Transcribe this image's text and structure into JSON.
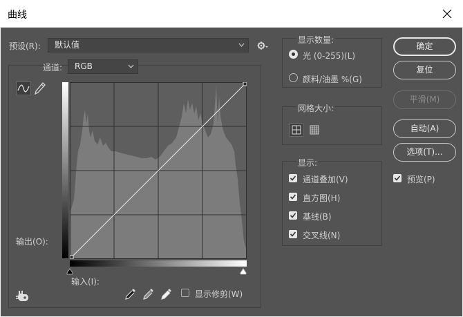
{
  "window": {
    "title": "曲线",
    "close_glyph": "✕"
  },
  "preset": {
    "label": "预设(R):",
    "value": "默认值",
    "gear_icon": "gear-icon"
  },
  "channel": {
    "label": "通道:",
    "value": "RGB"
  },
  "curve_tools": {
    "curve_icon": "curve-icon",
    "pencil_icon": "pencil-icon"
  },
  "output": {
    "label": "输出(O):"
  },
  "input": {
    "label": "输入(I):"
  },
  "show_clipping": {
    "label": "显示修剪(W)",
    "checked": false
  },
  "display_amount": {
    "title": "显示数量:",
    "options": [
      {
        "label": "光 (0-255)(L)",
        "selected": true
      },
      {
        "label": "颜料/油墨 %(G)",
        "selected": false
      }
    ]
  },
  "grid_size": {
    "title": "网格大小:",
    "simple_icon": "grid-4-icon",
    "detailed_icon": "grid-10-icon"
  },
  "show": {
    "title": "显示:",
    "items": [
      {
        "label": "通道叠加(V)",
        "checked": true
      },
      {
        "label": "直方图(H)",
        "checked": true
      },
      {
        "label": "基线(B)",
        "checked": true
      },
      {
        "label": "交叉线(N)",
        "checked": true
      }
    ]
  },
  "buttons": {
    "ok": "确定",
    "reset": "复位",
    "smooth": "平滑(M)",
    "auto": "自动(A)",
    "options": "选项(T)..."
  },
  "preview": {
    "label": "预览(P)",
    "checked": true
  },
  "colors": {
    "dialog_bg": "#535353",
    "graph_bg": "#5e5e5e",
    "histogram": "#7c7c7c",
    "curve": "#e8e8e8"
  }
}
